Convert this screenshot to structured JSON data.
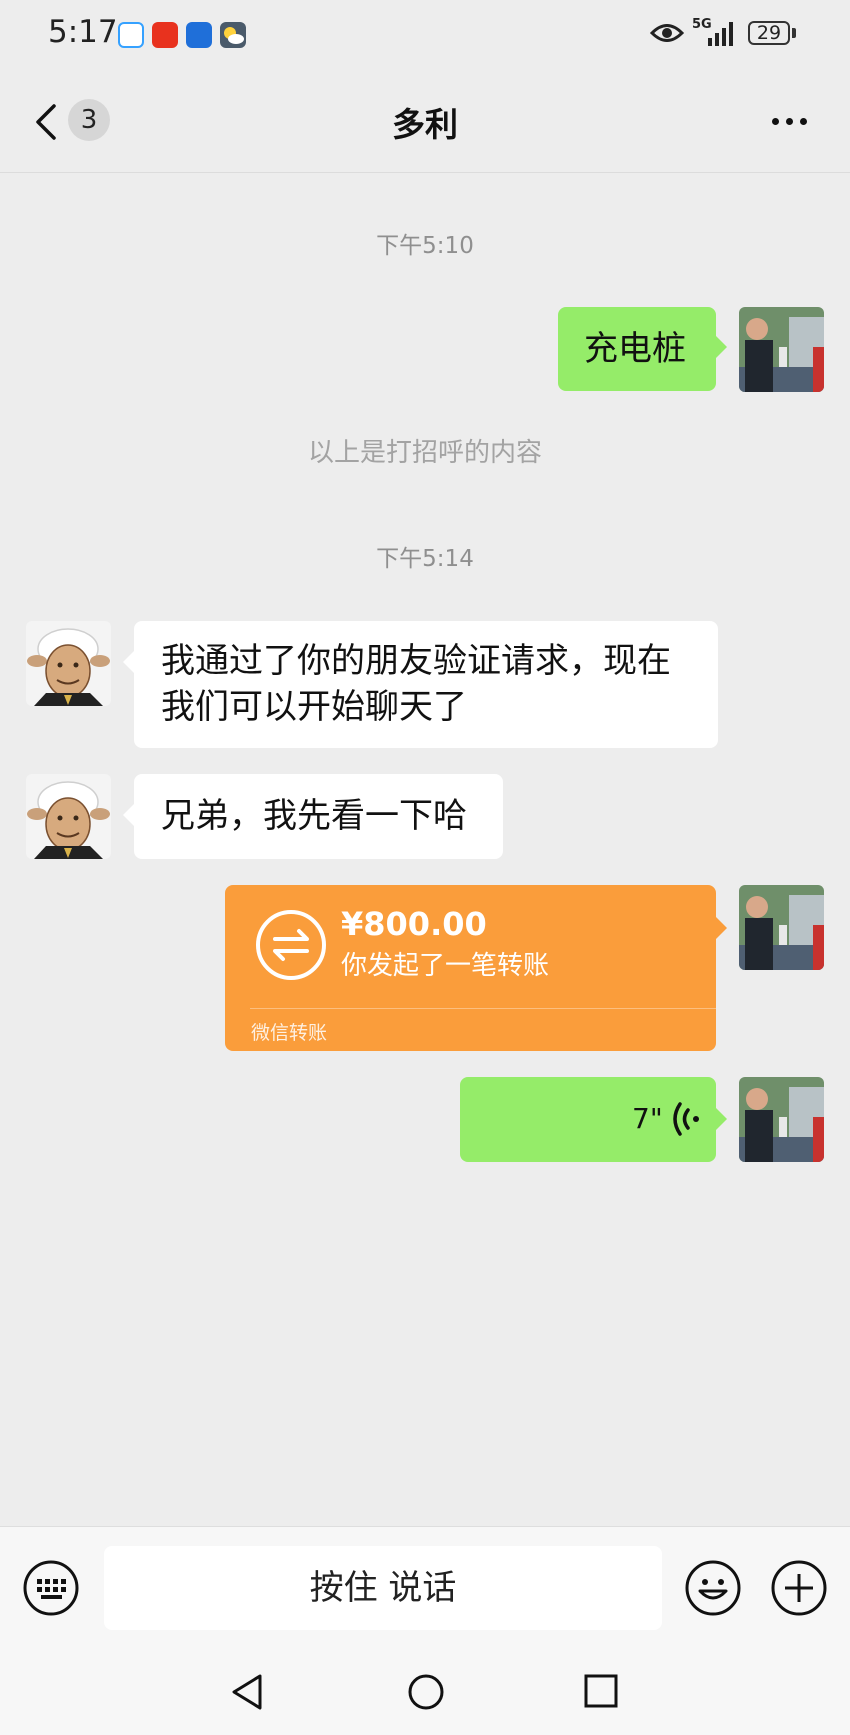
{
  "status_bar": {
    "time": "5:17",
    "network": "5G",
    "battery": "29",
    "app_icons": [
      "browser-icon",
      "shopping-app-icon",
      "traffic-app-icon",
      "weather-icon"
    ],
    "eye_icon": "eye-icon"
  },
  "header": {
    "unread_count": "3",
    "title": "多利",
    "back_icon": "chevron-left-icon",
    "more_icon": "more-dots-icon"
  },
  "messages": {
    "time1": "下午5:10",
    "m1_text": "充电桩",
    "greeting_hint": "以上是打招呼的内容",
    "time2": "下午5:14",
    "m2_text": "我通过了你的朋友验证请求，现在我们可以开始聊天了",
    "m3_text": "兄弟，我先看一下哈",
    "transfer": {
      "amount": "¥800.00",
      "description": "你发起了一笔转账",
      "source": "微信转账",
      "color": "#fa9d3b"
    },
    "voice": {
      "duration": "7\""
    }
  },
  "input_bar": {
    "hold_to_talk": "按住 说话",
    "icons": [
      "keyboard-icon",
      "emoji-icon",
      "plus-icon"
    ]
  },
  "colors": {
    "my_bubble": "#95ec69",
    "their_bubble": "#ffffff",
    "background": "#ededed"
  }
}
